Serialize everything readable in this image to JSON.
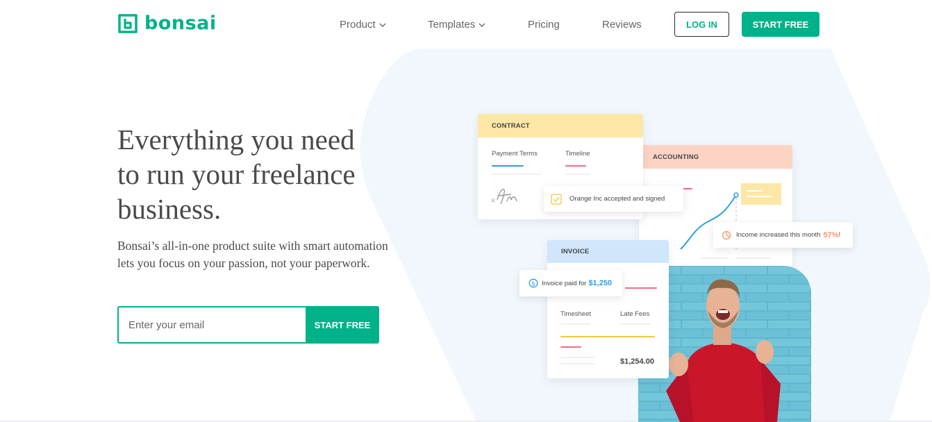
{
  "brand": {
    "name": "bonsai",
    "color": "#00b289"
  },
  "nav": {
    "items": [
      {
        "label": "Product",
        "dropdown": true
      },
      {
        "label": "Templates",
        "dropdown": true
      },
      {
        "label": "Pricing",
        "dropdown": false
      },
      {
        "label": "Reviews",
        "dropdown": false
      }
    ],
    "login_label": "LOG IN",
    "start_label": "START FREE"
  },
  "hero": {
    "title": "Everything you need to run your freelance business.",
    "subtitle": "Bonsai’s all-in-one product suite with smart automation lets you focus on your passion, not your paperwork.",
    "email_placeholder": "Enter your email",
    "cta_label": "START FREE"
  },
  "illustration": {
    "contract": {
      "header": "CONTRACT",
      "col1": "Payment Terms",
      "col2": "Timeline"
    },
    "signed_note": "Orange Inc accepted and signed",
    "accounting": {
      "header": "ACCOUNTING"
    },
    "income_note": {
      "text": "Income increased this month",
      "value": "57%",
      "suffix": "!"
    },
    "invoice": {
      "header": "INVOICE",
      "col1": "Timesheet",
      "col2": "Late Fees",
      "total": "$1,254.00"
    },
    "paid_note": {
      "text": "Invoice paid for",
      "amount": "$1,250"
    }
  },
  "colors": {
    "accent": "#00b289",
    "contract_header": "#fde7a6",
    "accounting_header": "#fdd4c4",
    "invoice_header": "#cfe6fb",
    "income_value": "#f4956a",
    "paid_amount": "#2e9be6",
    "blob": "#f1f7fd"
  }
}
